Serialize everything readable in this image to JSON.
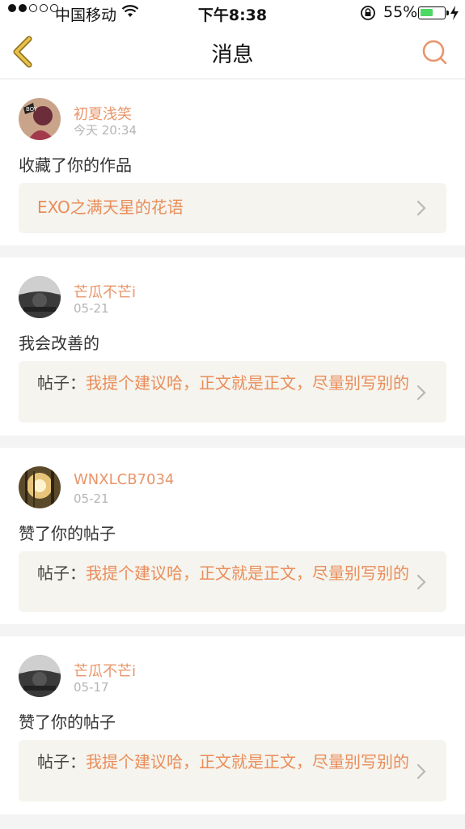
{
  "status": {
    "carrier": "中国移动",
    "time": "下午8:38",
    "battery_pct": "55%",
    "battery_level": 0.55
  },
  "nav": {
    "title": "消息",
    "back_icon": "chevron-left-icon",
    "search_icon": "search-icon"
  },
  "messages": [
    {
      "user": "初夏浅笑",
      "date": "今天 20:34",
      "action": "收藏了你的作品",
      "ref_prefix": "",
      "ref_text": "EXO之满天星的花语"
    },
    {
      "user": "芒瓜不芒i",
      "date": "05-21",
      "action": "我会改善的",
      "ref_prefix": "帖子：",
      "ref_text": "我提个建议哈，正文就是正文，尽量别写别的"
    },
    {
      "user": "WNXLCB7034",
      "date": "05-21",
      "action": "赞了你的帖子",
      "ref_prefix": "帖子：",
      "ref_text": "我提个建议哈，正文就是正文，尽量别写别的"
    },
    {
      "user": "芒瓜不芒i",
      "date": "05-17",
      "action": "赞了你的帖子",
      "ref_prefix": "帖子：",
      "ref_text": "我提个建议哈，正文就是正文，尽量别写别的"
    }
  ],
  "colors": {
    "accent": "#e8956a",
    "link": "#ea8d5a",
    "ref_bg": "#f5f4ee",
    "back_icon": "#e8c04a"
  }
}
